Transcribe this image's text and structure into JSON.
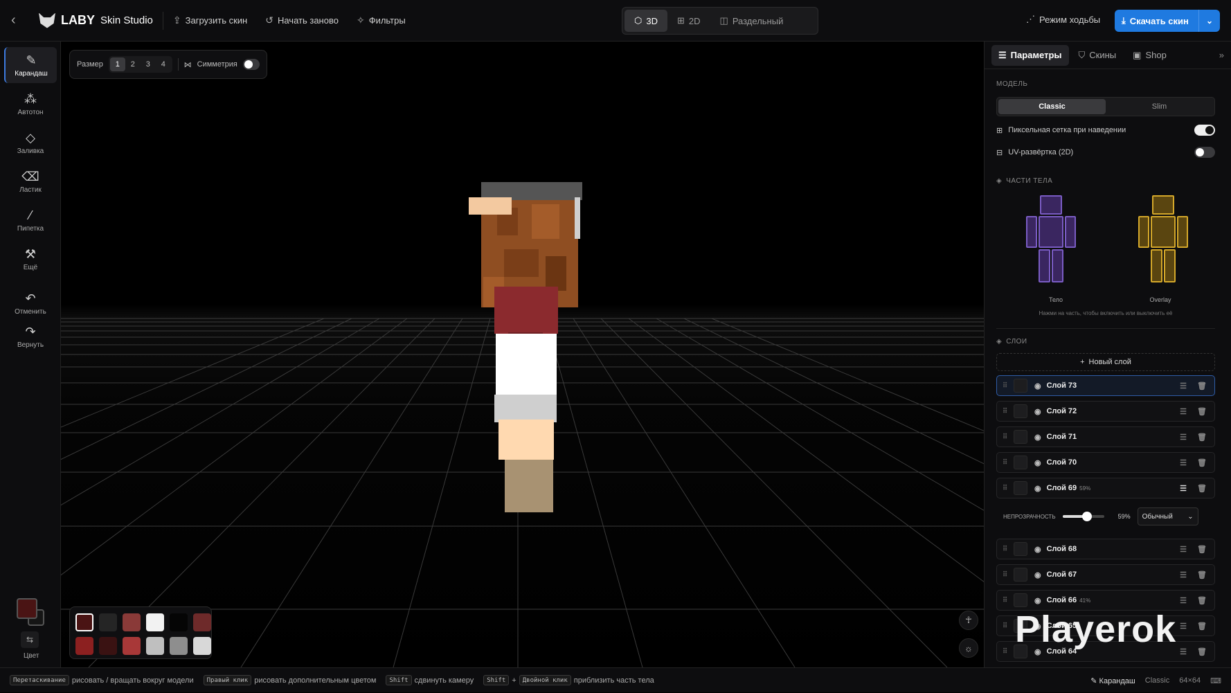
{
  "header": {
    "logo_brand": "LABY",
    "logo_product": "Skin Studio",
    "upload": "Загрузить скин",
    "restart": "Начать заново",
    "filters": "Фильтры",
    "walk_mode": "Режим ходьбы",
    "download": "Скачать скин"
  },
  "view_modes": [
    {
      "label": "3D",
      "active": true
    },
    {
      "label": "2D",
      "active": false
    },
    {
      "label": "Раздельный",
      "active": false
    }
  ],
  "tools": [
    {
      "label": "Карандаш",
      "icon": "pencil-icon",
      "active": true
    },
    {
      "label": "Автотон",
      "icon": "spray-icon"
    },
    {
      "label": "Заливка",
      "icon": "bucket-icon"
    },
    {
      "label": "Ластик",
      "icon": "eraser-icon"
    },
    {
      "label": "Пипетка",
      "icon": "eyedropper-icon"
    },
    {
      "label": "Ещё",
      "icon": "wrench-icon"
    },
    {
      "label": "Отменить",
      "icon": "undo-icon"
    },
    {
      "label": "Вернуть",
      "icon": "redo-icon"
    }
  ],
  "color": {
    "label": "Цвет",
    "primary": "#4a1414",
    "secondary": "#151515"
  },
  "brush": {
    "size_label": "Размер",
    "sizes": [
      "1",
      "2",
      "3",
      "4"
    ],
    "selected_size": "1",
    "symmetry_label": "Симметрия",
    "symmetry_on": false
  },
  "palette": [
    "#4a1414",
    "#252525",
    "#8a3a38",
    "#f2f2f2",
    "#050505",
    "#6e2a2a",
    "#8c2020",
    "#3a1212",
    "#a83838",
    "#bfbfbf",
    "#8e8e8e",
    "#d8d8d8"
  ],
  "panel": {
    "tabs": [
      {
        "label": "Параметры",
        "active": true
      },
      {
        "label": "Скины"
      },
      {
        "label": "Shop"
      }
    ],
    "model_label": "МОДЕЛЬ",
    "model_options": [
      "Classic",
      "Slim"
    ],
    "model_selected": "Classic",
    "pixel_grid_label": "Пиксельная сетка при наведении",
    "pixel_grid_on": true,
    "uv_label": "UV-развёртка (2D)",
    "uv_on": false,
    "body_parts_label": "ЧАСТИ ТЕЛА",
    "body_label": "Тело",
    "overlay_label": "Overlay",
    "body_color": "#6b4aa8",
    "overlay_color": "#c49a1f",
    "body_parts_hint": "Нажми на часть, чтобы включить или выключить её",
    "layers_label": "СЛОИ",
    "new_layer": "Новый слой",
    "layers": [
      {
        "name": "Слой 73",
        "pct": "",
        "active": true
      },
      {
        "name": "Слой 72",
        "pct": ""
      },
      {
        "name": "Слой 71",
        "pct": ""
      },
      {
        "name": "Слой 70",
        "pct": ""
      },
      {
        "name": "Слой 69",
        "pct": "59%"
      },
      {
        "name": "Слой 68",
        "pct": ""
      },
      {
        "name": "Слой 67",
        "pct": ""
      },
      {
        "name": "Слой 66",
        "pct": "41%"
      },
      {
        "name": "Слой 65",
        "pct": ""
      },
      {
        "name": "Слой 64",
        "pct": ""
      }
    ],
    "opacity_label": "НЕПРОЗРАЧНОСТЬ",
    "opacity_value": "59%",
    "opacity_fraction": 0.59,
    "blend_mode": "Обычный"
  },
  "watermark": "Playerok",
  "status": {
    "hints": [
      {
        "keys": [
          "Перетаскивание"
        ],
        "text": "рисовать / вращать вокруг модели"
      },
      {
        "keys": [
          "Правый клик"
        ],
        "text": "рисовать дополнительным цветом"
      },
      {
        "keys": [
          "Shift"
        ],
        "text": "сдвинуть камеру"
      },
      {
        "keys": [
          "Shift",
          "Двойной клик"
        ],
        "text": "приблизить часть тела"
      }
    ],
    "tool": "Карандаш",
    "model": "Classic",
    "resolution": "64×64"
  }
}
